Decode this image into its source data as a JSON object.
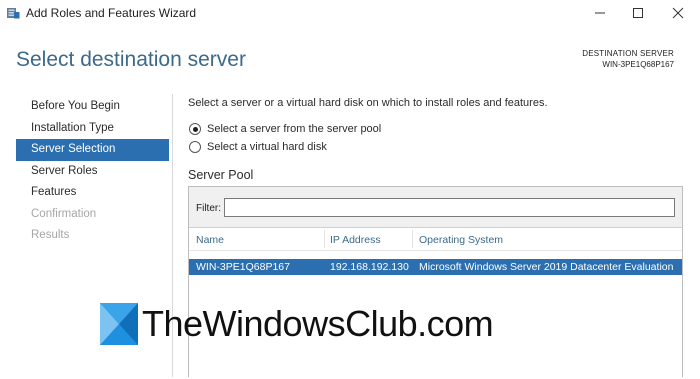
{
  "window": {
    "title": "Add Roles and Features Wizard",
    "icon": "server-manager-icon"
  },
  "header": {
    "title": "Select destination server",
    "destination_label": "DESTINATION SERVER",
    "destination_value": "WIN-3PE1Q68P167"
  },
  "nav": {
    "items": [
      {
        "label": "Before You Begin",
        "state": "normal"
      },
      {
        "label": "Installation Type",
        "state": "normal"
      },
      {
        "label": "Server Selection",
        "state": "selected"
      },
      {
        "label": "Server Roles",
        "state": "normal"
      },
      {
        "label": "Features",
        "state": "normal"
      },
      {
        "label": "Confirmation",
        "state": "disabled"
      },
      {
        "label": "Results",
        "state": "disabled"
      }
    ]
  },
  "content": {
    "instruction": "Select a server or a virtual hard disk on which to install roles and features.",
    "options": [
      {
        "label": "Select a server from the server pool",
        "selected": true
      },
      {
        "label": "Select a virtual hard disk",
        "selected": false
      }
    ],
    "pool": {
      "title": "Server Pool",
      "filter_label": "Filter:",
      "filter_value": "",
      "columns": [
        "Name",
        "IP Address",
        "Operating System"
      ],
      "rows": [
        {
          "name": "WIN-3PE1Q68P167",
          "ip": "192.168.192.130",
          "os": "Microsoft Windows Server 2019 Datacenter Evaluation"
        }
      ]
    }
  },
  "watermark": {
    "text": "TheWindowsClub.com"
  },
  "colors": {
    "accent": "#2b6fb0",
    "header_text": "#3c6a8a",
    "disabled_text": "#a6a6a6"
  }
}
